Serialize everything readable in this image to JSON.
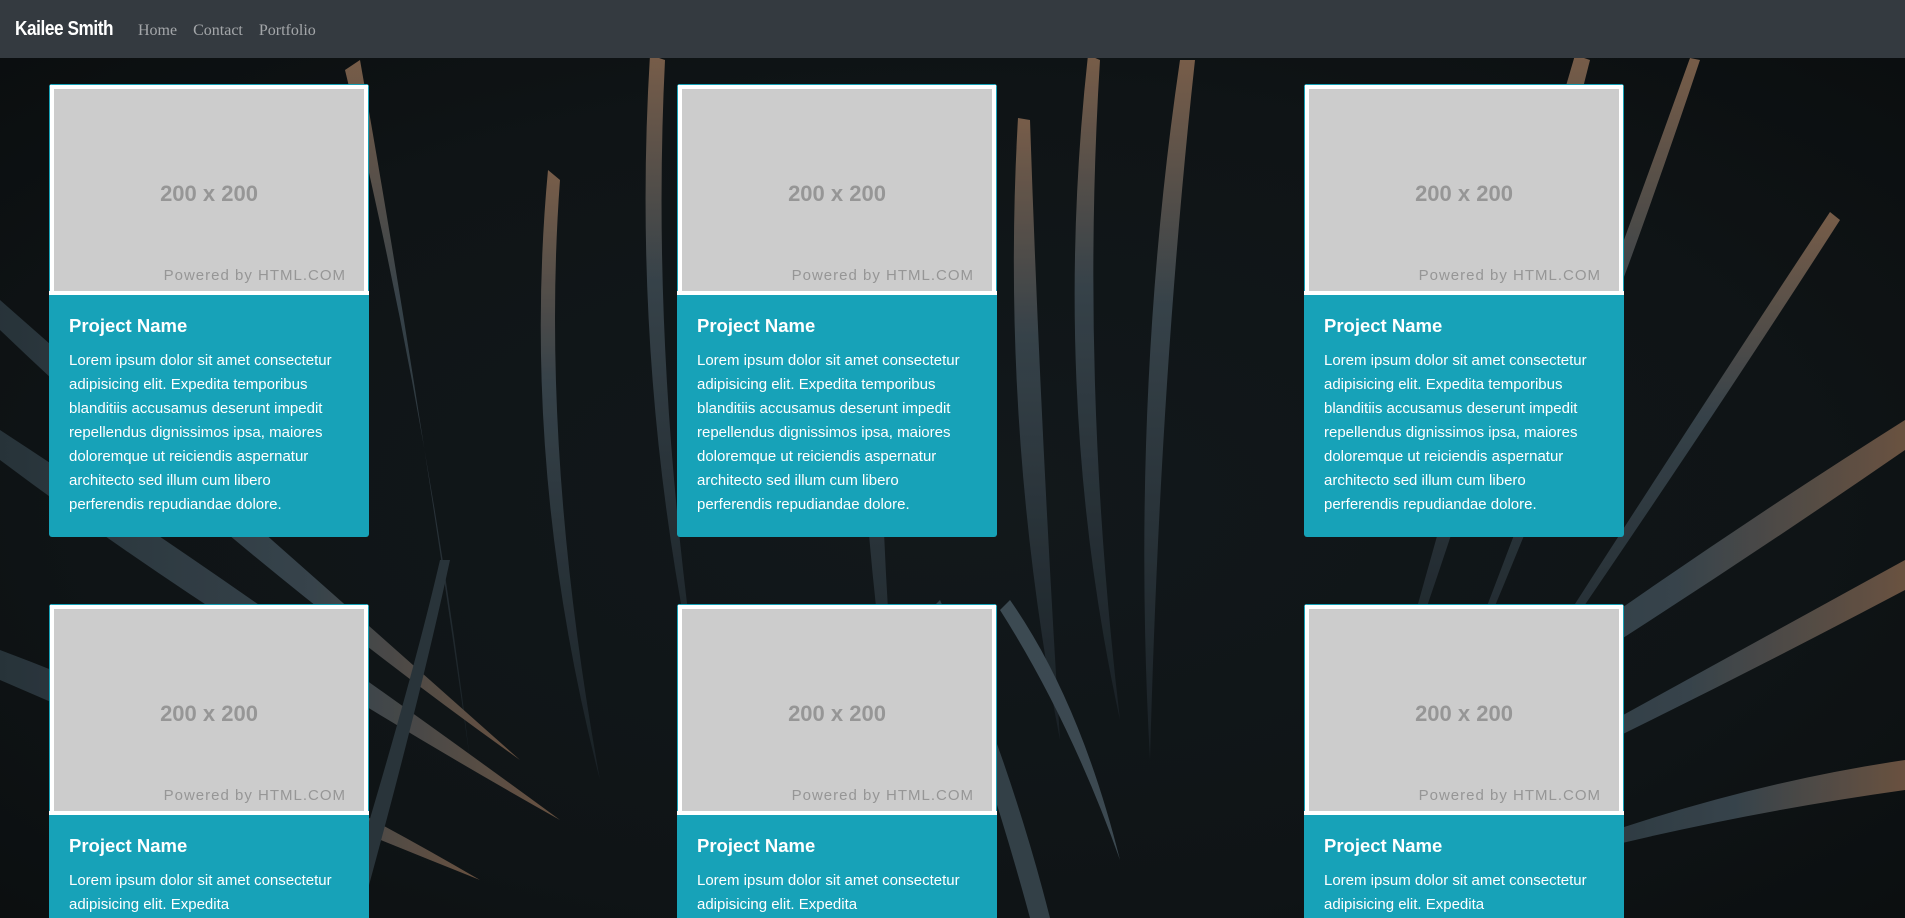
{
  "navbar": {
    "brand": "Kailee Smith",
    "links": [
      "Home",
      "Contact",
      "Portfolio"
    ]
  },
  "cards": [
    {
      "thumb_size": "200 x 200",
      "thumb_powered": "Powered by HTML.COM",
      "title": "Project Name",
      "text": "Lorem ipsum dolor sit amet consectetur adipisicing elit. Expedita temporibus blanditiis accusamus deserunt impedit repellendus dignissimos ipsa, maiores doloremque ut reiciendis aspernatur architecto sed illum cum libero perferendis repudiandae dolore."
    },
    {
      "thumb_size": "200 x 200",
      "thumb_powered": "Powered by HTML.COM",
      "title": "Project Name",
      "text": "Lorem ipsum dolor sit amet consectetur adipisicing elit. Expedita temporibus blanditiis accusamus deserunt impedit repellendus dignissimos ipsa, maiores doloremque ut reiciendis aspernatur architecto sed illum cum libero perferendis repudiandae dolore."
    },
    {
      "thumb_size": "200 x 200",
      "thumb_powered": "Powered by HTML.COM",
      "title": "Project Name",
      "text": "Lorem ipsum dolor sit amet consectetur adipisicing elit. Expedita temporibus blanditiis accusamus deserunt impedit repellendus dignissimos ipsa, maiores doloremque ut reiciendis aspernatur architecto sed illum cum libero perferendis repudiandae dolore."
    },
    {
      "thumb_size": "200 x 200",
      "thumb_powered": "Powered by HTML.COM",
      "title": "Project Name",
      "text": "Lorem ipsum dolor sit amet consectetur adipisicing elit. Expedita"
    },
    {
      "thumb_size": "200 x 200",
      "thumb_powered": "Powered by HTML.COM",
      "title": "Project Name",
      "text": "Lorem ipsum dolor sit amet consectetur adipisicing elit. Expedita"
    },
    {
      "thumb_size": "200 x 200",
      "thumb_powered": "Powered by HTML.COM",
      "title": "Project Name",
      "text": "Lorem ipsum dolor sit amet consectetur adipisicing elit. Expedita"
    }
  ],
  "colors": {
    "navbar_bg": "#343a40",
    "card_bg": "#17a2b8",
    "placeholder_bg": "#cccccc",
    "placeholder_text": "#969696"
  }
}
